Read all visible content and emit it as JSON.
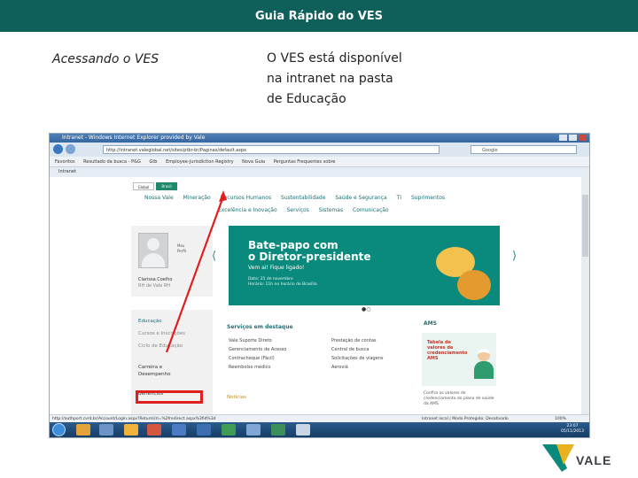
{
  "header": {
    "title": "Guia Rápido do VES"
  },
  "section_label": "Acessando o VES",
  "description": "O VES está disponível na intranet na pasta de Educação",
  "screenshot": {
    "window_title": "Intranet - Windows Internet Explorer provided by Vale",
    "address": "http://intranet.valeglobal.net/sites/ptbr-br/Paginas/default.aspx",
    "search_placeholder": "Google",
    "favorites": [
      "Favoritos",
      "Resultado da busca - P&G",
      "Gtb",
      "Employee-Jurisdiction Registry",
      "Nova Guia",
      "Perguntas Frequentes sobre"
    ],
    "tab_label": "Intranet",
    "page_tabs": [
      "Global",
      "Brasil"
    ],
    "menu_primary": [
      "Nossa Vale",
      "Mineração",
      "Recursos Humanos",
      "Sustentabilidade",
      "Saúde e Segurança",
      "TI",
      "Suprimentos"
    ],
    "menu_secondary": [
      "Excelência e Inovação",
      "Serviços",
      "Sistemas",
      "Comunicação"
    ],
    "profile": {
      "meta": [
        "Meu",
        "Perfil"
      ],
      "name": "Clarissa Coelho",
      "role": "RH de Vale RH"
    },
    "left_nav": [
      "Educação",
      "Cursos e Inscrições",
      "Ciclo de Educação",
      "Carreira e",
      "Desempenho",
      "Benefícios"
    ],
    "banner": {
      "title_line1": "Bate-papo com",
      "title_line2": "o Diretor-presidente",
      "subtitle": "Vem ai! Fique ligado!",
      "detail1": "Data: 25 de novembro",
      "detail2": "Horário: 11h no horário de Brasília"
    },
    "carousel_dots": "●○",
    "services": {
      "title": "Serviços em destaque",
      "items": [
        "Vale Suporte Direto",
        "Gerenciamento de Acesso",
        "Contracheque (Fácil)",
        "Reembolso médico"
      ],
      "items_right": [
        "Prestação de contas",
        "Central de busca",
        "Solicitações de viagens",
        "Aeroviá"
      ]
    },
    "noticias": "Notícias",
    "ams": {
      "title": "AMS",
      "box_text": [
        "Tabela de",
        "valores de",
        "credenciamento",
        "AMS"
      ],
      "footer": [
        "Confira os valores de",
        "credenciamento do plano de saúde",
        "da AMS"
      ]
    },
    "status": {
      "url": "http://authport.cvrd.br/Account/Login.aspx?ReturnUrl=%2fredirect.aspx%3fid%3d",
      "mode": "Intranet local | Modo Protegido: Desativado",
      "zoom": "100%"
    },
    "taskbar_time": [
      "23:07",
      "05/11/2013"
    ]
  },
  "logo": {
    "text": "VALE"
  },
  "colors": {
    "header_bg": "#0f5f5a",
    "highlight": "#e0201e",
    "vale_green": "#0a8a7c",
    "vale_yellow": "#e9b21e"
  }
}
